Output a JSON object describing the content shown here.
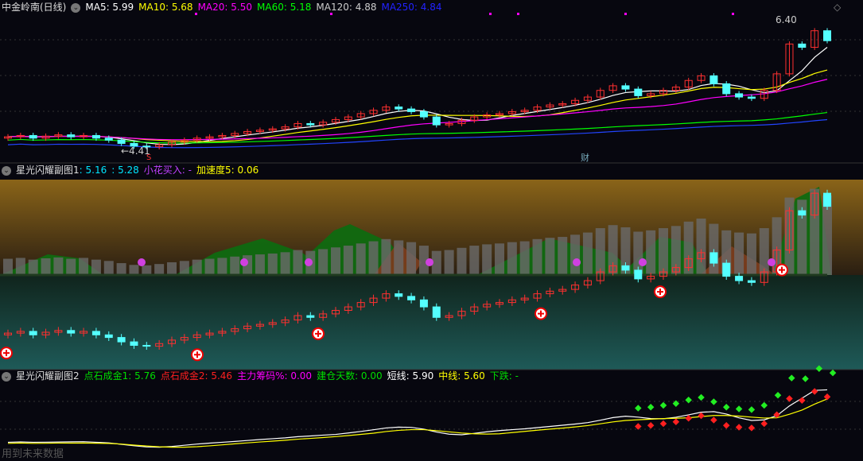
{
  "main": {
    "title": "中金岭南(日线)",
    "indicators": [
      {
        "label": "MA5: 5.99",
        "color": "#ffffff"
      },
      {
        "label": "MA10: 5.68",
        "color": "#ffff00"
      },
      {
        "label": "MA20: 5.50",
        "color": "#ff00ff"
      },
      {
        "label": "MA60: 5.18",
        "color": "#00ff00"
      },
      {
        "label": "MA120: 4.88",
        "color": "#cccccc"
      },
      {
        "label": "MA250: 4.84",
        "color": "#2222ff"
      }
    ],
    "high_label": "6.40",
    "low_label": "←4.41",
    "s_mark": "S",
    "cai_mark": "财"
  },
  "sub1": {
    "title": "星光闪耀副图1",
    "v1": ": 5.16",
    "v2": ": 5.28",
    "flower": "小花买入: -",
    "accel": "加速度5: 0.06"
  },
  "sub2": {
    "title": "星光闪耀副图2",
    "items": [
      {
        "label": "点石成金1: 5.76",
        "color": "#00dd00"
      },
      {
        "label": "点石成金2: 5.46",
        "color": "#ff2020"
      },
      {
        "label": "主力筹码%: 0.00",
        "color": "#ff00ff"
      },
      {
        "label": "建仓天数: 0.00",
        "color": "#00dd00"
      },
      {
        "label": "短线: 5.90",
        "color": "#ffffff"
      },
      {
        "label": "中线: 5.60",
        "color": "#ffff00"
      },
      {
        "label": "下跌: -",
        "color": "#00dd00"
      }
    ]
  },
  "watermark": "用到未来数据",
  "chart_data": {
    "type": "candlestick",
    "closes": [
      4.6,
      4.62,
      4.58,
      4.61,
      4.63,
      4.6,
      4.62,
      4.58,
      4.55,
      4.5,
      4.46,
      4.45,
      4.48,
      4.52,
      4.55,
      4.58,
      4.6,
      4.62,
      4.65,
      4.68,
      4.7,
      4.72,
      4.75,
      4.8,
      4.78,
      4.82,
      4.86,
      4.9,
      4.95,
      5.0,
      5.05,
      5.02,
      4.98,
      4.9,
      4.78,
      4.8,
      4.85,
      4.9,
      4.93,
      4.95,
      4.98,
      5.0,
      5.05,
      5.08,
      5.1,
      5.15,
      5.2,
      5.3,
      5.37,
      5.32,
      5.22,
      5.25,
      5.3,
      5.35,
      5.45,
      5.52,
      5.4,
      5.25,
      5.2,
      5.18,
      5.3,
      5.55,
      6.0,
      5.95,
      6.2,
      6.05
    ],
    "ylim": [
      4.41,
      6.4
    ]
  }
}
